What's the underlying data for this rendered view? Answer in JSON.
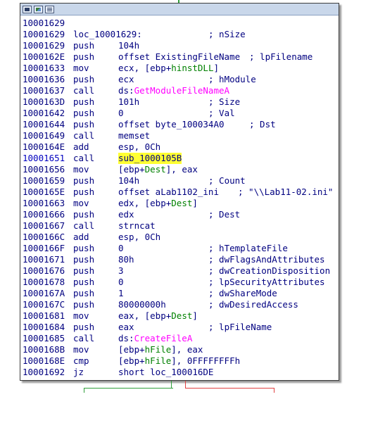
{
  "graph": {
    "edge_colors": {
      "true_branch": "#2f9e3a",
      "false_branch": "#e04040"
    }
  },
  "node": {
    "titlebar_icons": [
      "window-icon",
      "graph-view-icon",
      "text-view-icon"
    ],
    "lines": [
      {
        "addr": "10001629",
        "mn": "",
        "op": "",
        "cm": ""
      },
      {
        "addr": "10001629",
        "mn": "loc_10001629:",
        "op": "",
        "cm": "; nSize"
      },
      {
        "addr": "10001629",
        "mn": "push",
        "op": "104h",
        "cm": ""
      },
      {
        "addr": "1000162E",
        "mn": "push",
        "op": "offset ExistingFileName",
        "cm": "; lpFilename"
      },
      {
        "addr": "10001633",
        "mn": "mov",
        "op": "ecx, [ebp+hinstDLL]",
        "cm": ""
      },
      {
        "addr": "10001636",
        "mn": "push",
        "op": "ecx",
        "cm": "; hModule"
      },
      {
        "addr": "10001637",
        "mn": "call",
        "op": "ds:GetModuleFileNameA",
        "cm": ""
      },
      {
        "addr": "1000163D",
        "mn": "push",
        "op": "101h",
        "cm": "; Size"
      },
      {
        "addr": "10001642",
        "mn": "push",
        "op": "0",
        "cm": "; Val"
      },
      {
        "addr": "10001644",
        "mn": "push",
        "op": "offset byte_100034A0",
        "cm": "; Dst"
      },
      {
        "addr": "10001649",
        "mn": "call",
        "op": "memset",
        "cm": ""
      },
      {
        "addr": "1000164E",
        "mn": "add",
        "op": "esp, 0Ch",
        "cm": ""
      },
      {
        "addr": "10001651",
        "mn": "call",
        "op": "sub_1000105B",
        "cm": ""
      },
      {
        "addr": "10001656",
        "mn": "mov",
        "op": "[ebp+Dest], eax",
        "cm": ""
      },
      {
        "addr": "10001659",
        "mn": "push",
        "op": "104h",
        "cm": "; Count"
      },
      {
        "addr": "1000165E",
        "mn": "push",
        "op": "offset aLab1102_ini",
        "cm": "; \"\\\\Lab11-02.ini\""
      },
      {
        "addr": "10001663",
        "mn": "mov",
        "op": "edx, [ebp+Dest]",
        "cm": ""
      },
      {
        "addr": "10001666",
        "mn": "push",
        "op": "edx",
        "cm": "; Dest"
      },
      {
        "addr": "10001667",
        "mn": "call",
        "op": "strncat",
        "cm": ""
      },
      {
        "addr": "1000166C",
        "mn": "add",
        "op": "esp, 0Ch",
        "cm": ""
      },
      {
        "addr": "1000166F",
        "mn": "push",
        "op": "0",
        "cm": "; hTemplateFile"
      },
      {
        "addr": "10001671",
        "mn": "push",
        "op": "80h",
        "cm": "; dwFlagsAndAttributes"
      },
      {
        "addr": "10001676",
        "mn": "push",
        "op": "3",
        "cm": "; dwCreationDisposition"
      },
      {
        "addr": "10001678",
        "mn": "push",
        "op": "0",
        "cm": "; lpSecurityAttributes"
      },
      {
        "addr": "1000167A",
        "mn": "push",
        "op": "1",
        "cm": "; dwShareMode"
      },
      {
        "addr": "1000167C",
        "mn": "push",
        "op": "80000000h",
        "cm": "; dwDesiredAccess"
      },
      {
        "addr": "10001681",
        "mn": "mov",
        "op": "eax, [ebp+Dest]",
        "cm": ""
      },
      {
        "addr": "10001684",
        "mn": "push",
        "op": "eax",
        "cm": "; lpFileName"
      },
      {
        "addr": "10001685",
        "mn": "call",
        "op": "ds:CreateFileA",
        "cm": ""
      },
      {
        "addr": "1000168B",
        "mn": "mov",
        "op": "[ebp+hFile], eax",
        "cm": ""
      },
      {
        "addr": "1000168E",
        "mn": "cmp",
        "op": "[ebp+hFile], 0FFFFFFFFh",
        "cm": ""
      },
      {
        "addr": "10001692",
        "mn": "jz",
        "op": "short loc_100016DE",
        "cm": ""
      }
    ]
  }
}
